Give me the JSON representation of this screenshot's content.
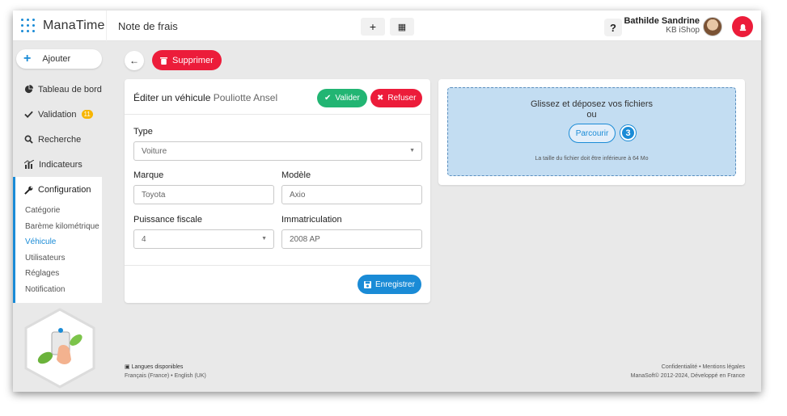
{
  "app": {
    "name": "ManaTime",
    "page_title": "Note de frais"
  },
  "topbar": {
    "plus_icon": "plus-icon",
    "calendar_icon": "calendar-icon",
    "help_label": "?",
    "user_name": "Bathilde Sandrine",
    "company": "KB iShop"
  },
  "sidebar": {
    "add_label": "Ajouter",
    "items": [
      {
        "label": "Tableau de bord",
        "icon": "pie-chart-icon"
      },
      {
        "label": "Validation",
        "icon": "check-icon",
        "badge": "11"
      },
      {
        "label": "Recherche",
        "icon": "search-icon"
      },
      {
        "label": "Indicateurs",
        "icon": "bar-chart-icon"
      }
    ],
    "config": {
      "label": "Configuration",
      "subitems": [
        "Catégorie",
        "Barème kilométrique",
        "Véhicule",
        "Utilisateurs",
        "Réglages",
        "Notification"
      ],
      "active": "Véhicule"
    }
  },
  "toolbar": {
    "delete_label": "Supprimer"
  },
  "form": {
    "title": "Éditer un véhicule",
    "vehicle_name": "Pouliotte Ansel",
    "valider_label": "Valider",
    "refuser_label": "Refuser",
    "type_label": "Type",
    "type_value": "Voiture",
    "marque_label": "Marque",
    "marque_value": "Toyota",
    "modele_label": "Modèle",
    "modele_value": "Axio",
    "puissance_label": "Puissance fiscale",
    "puissance_value": "4",
    "immat_label": "Immatriculation",
    "immat_value": "2008 AP",
    "save_label": "Enregistrer"
  },
  "upload": {
    "line1": "Glissez et déposez vos fichiers",
    "line2": "ou",
    "browse_label": "Parcourir",
    "step": "3",
    "note": "La taille du fichier doit être inférieure à 64 Mo"
  },
  "footer": {
    "languages_title": "Langues disponibles",
    "languages": "Français (France) • English (UK)",
    "links": "Confidentialité • Mentions légales",
    "copyright": "ManaSoft© 2012-2024, Développé en France"
  },
  "colors": {
    "accent": "#1a8bd6",
    "danger": "#ec1c3a",
    "success": "#22b573",
    "warning": "#f7b500"
  }
}
